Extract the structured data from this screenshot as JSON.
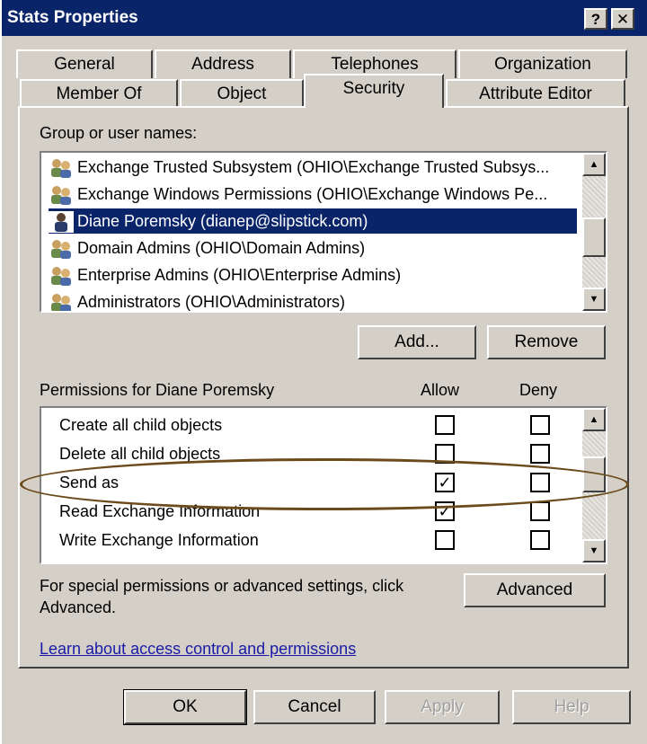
{
  "window": {
    "title": "Stats Properties",
    "help_glyph": "?",
    "close_glyph": "✕"
  },
  "tabs": {
    "row1": [
      "General",
      "Address",
      "Telephones",
      "Organization"
    ],
    "row2": [
      "Member Of",
      "Object",
      "Security",
      "Attribute Editor"
    ],
    "active": "Security"
  },
  "groups": {
    "label": "Group or user names:",
    "items": [
      {
        "text": "Exchange Trusted Subsystem (OHIO\\Exchange Trusted Subsys...",
        "icon": "group-icon",
        "selected": false
      },
      {
        "text": "Exchange Windows Permissions (OHIO\\Exchange Windows Pe...",
        "icon": "group-icon",
        "selected": false
      },
      {
        "text": "Diane Poremsky (dianep@slipstick.com)",
        "icon": "user-icon",
        "selected": true
      },
      {
        "text": "Domain Admins (OHIO\\Domain Admins)",
        "icon": "group-icon",
        "selected": false
      },
      {
        "text": "Enterprise Admins (OHIO\\Enterprise Admins)",
        "icon": "group-icon",
        "selected": false
      },
      {
        "text": "Administrators (OHIO\\Administrators)",
        "icon": "group-icon",
        "selected": false
      }
    ],
    "add_label": "Add...",
    "remove_label": "Remove"
  },
  "permissions": {
    "label": "Permissions for Diane Poremsky",
    "allow_header": "Allow",
    "deny_header": "Deny",
    "rows": [
      {
        "name": "Create all child objects",
        "allow": false,
        "deny": false
      },
      {
        "name": "Delete all child objects",
        "allow": false,
        "deny": false
      },
      {
        "name": "Send as",
        "allow": true,
        "deny": false
      },
      {
        "name": "Read Exchange Information",
        "allow": true,
        "deny": false
      },
      {
        "name": "Write Exchange Information",
        "allow": false,
        "deny": false
      }
    ],
    "highlighted_row": "Send as",
    "highlight_color": "#6b4a1c"
  },
  "advanced": {
    "text_line1": "For special permissions or advanced settings, click",
    "text_line2": "Advanced.",
    "button_label": "Advanced"
  },
  "link_text": "Learn about access control and permissions",
  "footer": {
    "ok": "OK",
    "cancel": "Cancel",
    "apply": "Apply",
    "help": "Help"
  },
  "colors": {
    "titlebar": "#0a246a",
    "selection": "#0a246a",
    "link": "#1a1aa8",
    "face": "#d4d0c8"
  }
}
